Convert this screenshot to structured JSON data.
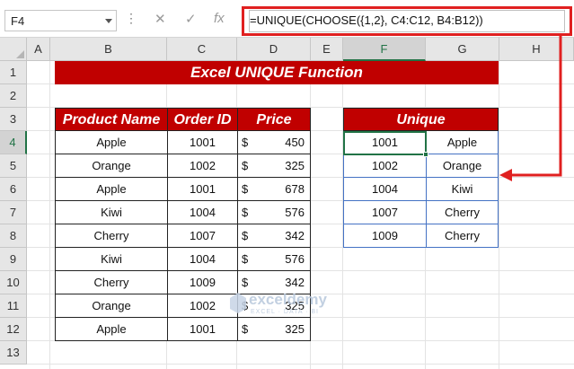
{
  "formula_bar": {
    "name_box": "F4",
    "dots": "⋮",
    "cancel_icon": "✕",
    "enter_icon": "✓",
    "fx_icon": "fx",
    "formula": "=UNIQUE(CHOOSE({1,2}, C4:C12, B4:B12))"
  },
  "columns": [
    "A",
    "B",
    "C",
    "D",
    "E",
    "F",
    "G",
    "H"
  ],
  "rows": [
    "1",
    "2",
    "3",
    "4",
    "5",
    "6",
    "7",
    "8",
    "9",
    "10",
    "11",
    "12",
    "13"
  ],
  "title": "Excel UNIQUE Function",
  "main_table": {
    "headers": [
      "Product Name",
      "Order ID",
      "Price"
    ],
    "currency": "$",
    "rows": [
      {
        "product": "Apple",
        "order_id": "1001",
        "price": "450"
      },
      {
        "product": "Orange",
        "order_id": "1002",
        "price": "325"
      },
      {
        "product": "Apple",
        "order_id": "1001",
        "price": "678"
      },
      {
        "product": "Kiwi",
        "order_id": "1004",
        "price": "576"
      },
      {
        "product": "Cherry",
        "order_id": "1007",
        "price": "342"
      },
      {
        "product": "Kiwi",
        "order_id": "1004",
        "price": "576"
      },
      {
        "product": "Cherry",
        "order_id": "1009",
        "price": "342"
      },
      {
        "product": "Orange",
        "order_id": "1002",
        "price": "325"
      },
      {
        "product": "Apple",
        "order_id": "1001",
        "price": "325"
      }
    ]
  },
  "unique_table": {
    "header": "Unique",
    "rows": [
      {
        "order_id": "1001",
        "product": "Apple"
      },
      {
        "order_id": "1002",
        "product": "Orange"
      },
      {
        "order_id": "1004",
        "product": "Kiwi"
      },
      {
        "order_id": "1007",
        "product": "Cherry"
      },
      {
        "order_id": "1009",
        "product": "Cherry"
      }
    ]
  },
  "watermark": {
    "name": "exceldemy",
    "tagline": "EXCEL · DATA · BI"
  },
  "colors": {
    "header_red": "#c00000",
    "highlight_red": "#e02020",
    "unique_border": "#4472c4",
    "selection_green": "#217346"
  }
}
